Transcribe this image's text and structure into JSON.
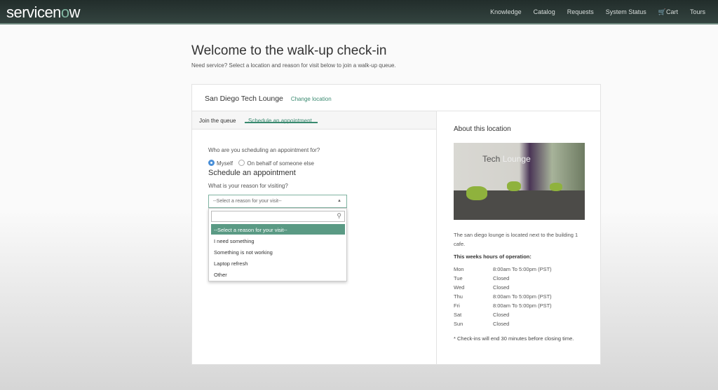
{
  "header": {
    "logo_pre": "servicen",
    "logo_o": "o",
    "logo_post": "w",
    "nav": [
      "Knowledge",
      "Catalog",
      "Requests",
      "System Status",
      "🛒Cart",
      "Tours"
    ]
  },
  "page": {
    "title": "Welcome to the walk-up check-in",
    "subtitle": "Need service? Select a location and reason for visit below to join a walk-up queue."
  },
  "location": {
    "name": "San Diego Tech Lounge",
    "change_label": "Change location"
  },
  "tabs": [
    {
      "label": "Join the queue",
      "active": false
    },
    {
      "label": "Schedule an appointment",
      "active": true
    }
  ],
  "form": {
    "who_label": "Who are you scheduling an appointment for?",
    "radio_options": [
      "Myself",
      "On behalf of someone else"
    ],
    "selected_radio": "Myself",
    "section_title": "Schedule an appointment",
    "reason_label": "What is your reason for visiting?",
    "select_value": "--Select a reason for your visit--",
    "search_value": "",
    "options": [
      "--Select a reason for your visit--",
      "I need something",
      "Something is not working",
      "Laptop refresh",
      "Other"
    ],
    "highlighted_option": 0
  },
  "about": {
    "title": "About this location",
    "image_text_1": "Tech",
    "image_text_2": "Lounge",
    "description": "The san diego lounge is located next to the building 1 cafe.",
    "hours_title": "This weeks hours of operation:",
    "hours": [
      [
        "Mon",
        "8:00am To 5:00pm (PST)"
      ],
      [
        "Tue",
        "Closed"
      ],
      [
        "Wed",
        "Closed"
      ],
      [
        "Thu",
        "8:00am To 5:00pm (PST)"
      ],
      [
        "Fri",
        "8:00am To 5:00pm (PST)"
      ],
      [
        "Sat",
        "Closed"
      ],
      [
        "Sun",
        "Closed"
      ]
    ],
    "note": "* Check-ins will end 30 minutes before closing time."
  },
  "colors": {
    "accent": "#3a8a70",
    "header_bg": "#2a3733",
    "highlight": "#5a9a84"
  }
}
